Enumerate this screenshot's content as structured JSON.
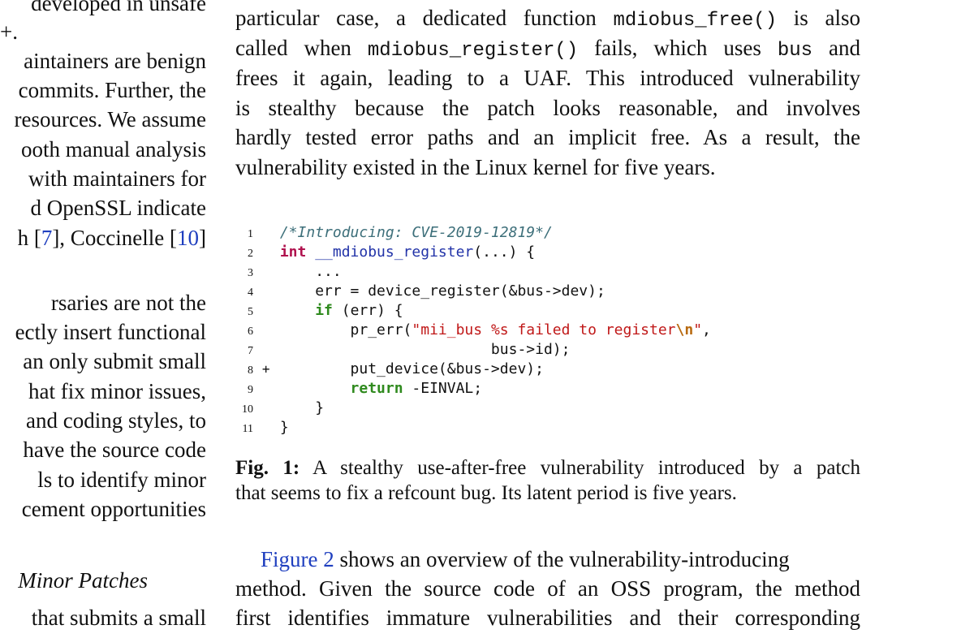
{
  "left_column": {
    "lines": [
      "developed in unsafe",
      "+.",
      "aintainers are benign",
      "commits. Further, the",
      "resources. We assume",
      "ooth manual analysis",
      "with maintainers for",
      "d OpenSSL indicate",
      "h [",
      "7",
      "], Coccinelle [",
      "10",
      "]",
      "rsaries are not the",
      "ectly insert functional",
      "an only submit small",
      "hat fix minor issues,",
      "and coding styles, to",
      "have the source code",
      "ls to identify minor",
      "cement opportunities",
      "Minor Patches",
      "that submits a small"
    ]
  },
  "right_column": {
    "p1": {
      "l1_a": "particular case, a dedicated function ",
      "l1_code": "mdiobus_free()",
      "l1_b": " is also",
      "l2_a": "called when ",
      "l2_code": "mdiobus_register()",
      "l2_b": " fails, which uses ",
      "l2_code2": "bus",
      "l2_c": " and",
      "l3": "frees it again, leading to a UAF. This introduced vulnerability",
      "l4": "is stealthy because the patch looks reasonable, and involves",
      "l5": "hardly tested error paths and an implicit free. As a result, the",
      "l6": "vulnerability existed in the Linux kernel for five years."
    },
    "code": {
      "line_numbers": [
        "1",
        "2",
        "3",
        "4",
        "5",
        "6",
        "7",
        "8",
        "9",
        "10",
        "11"
      ],
      "diff_mark": "+",
      "l1": "/*Introducing: CVE-2019-12819*/",
      "l2_kw": "int",
      "l2_fn": "__mdiobus_register",
      "l2_rest": "(...) {",
      "l3": "    ...",
      "l4": "    err = device_register(&bus->dev);",
      "l5_kw": "if",
      "l5_rest": " (err) {",
      "l6_a": "        pr_err(",
      "l6_str": "\"mii_bus %s failed to register",
      "l6_esc": "\\n",
      "l6_str2": "\"",
      "l6_b": ",",
      "l7": "                        bus->id);",
      "l8": "        put_device(&bus->dev);",
      "l9_kw": "return",
      "l9_rest": " -EINVAL;",
      "l10": "    }",
      "l11": "}"
    },
    "caption": {
      "label": "Fig. 1:",
      "l1": " A stealthy use-after-free vulnerability introduced by a patch",
      "l2": "that seems to fix a refcount bug. Its latent period is five years."
    },
    "p2": {
      "link": "Figure 2",
      "l1_rest": " shows an overview of the vulnerability-introducing",
      "l2": "method. Given the source code of an OSS program, the method",
      "l3": "first identifies immature vulnerabilities and their corresponding"
    }
  },
  "colors": {
    "link": "#1f3fbf",
    "comment": "#3d6f7a",
    "type_keyword": "#b0124e",
    "keyword": "#2f8a1e",
    "function": "#2233a8",
    "string": "#c01818"
  }
}
